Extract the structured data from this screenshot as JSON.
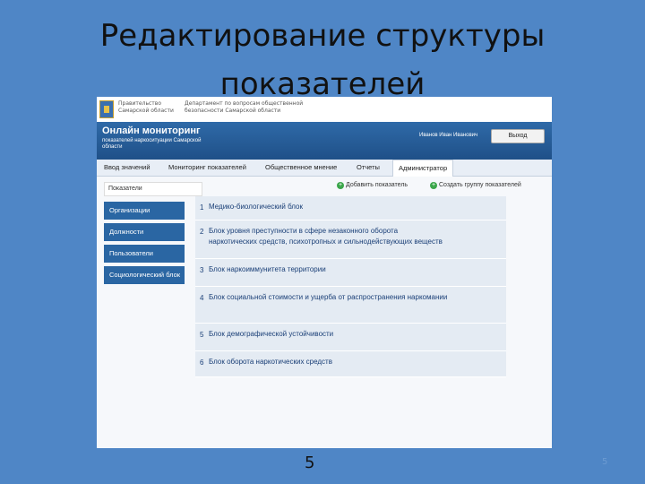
{
  "slide": {
    "title_line1": "Редактирование структуры",
    "title_line2": "показателей",
    "page_number": "5",
    "corner_number": "5"
  },
  "app": {
    "gov_label": "Правительство Самарской области",
    "dept_label": "Департамент по вопросам общественной безопасности Самарской области",
    "title": "Онлайн мониторинг",
    "subtitle": "показателей наркоситуации Самарской области",
    "user_name": "Иванов Иван Иванович",
    "logout_label": "Выход"
  },
  "tabs": [
    {
      "label": "Ввод значений"
    },
    {
      "label": "Мониторинг показателей"
    },
    {
      "label": "Общественное мнение"
    },
    {
      "label": "Отчеты"
    },
    {
      "label": "Администратор"
    }
  ],
  "toolbar": {
    "search_label": "Показатели",
    "add_indicator": "Добавить показатель",
    "add_group": "Создать группу показателей"
  },
  "sidebar": {
    "items": [
      {
        "label": "Организации"
      },
      {
        "label": "Должности"
      },
      {
        "label": "Пользователи"
      },
      {
        "label": "Социологический блок"
      }
    ]
  },
  "blocks": [
    {
      "num": "1",
      "line1": "Медико-биологический блок",
      "line2": ""
    },
    {
      "num": "2",
      "line1": "Блок уровня преступности в сфере незаконного оборота",
      "line2": "наркотических средств, психотропных и сильнодействующих веществ"
    },
    {
      "num": "3",
      "line1": "Блок наркоиммунитета территории",
      "line2": ""
    },
    {
      "num": "4",
      "line1": "Блок социальной стоимости и ущерба от распространения наркомании",
      "line2": ""
    },
    {
      "num": "5",
      "line1": "Блок демографической устойчивости",
      "line2": ""
    },
    {
      "num": "6",
      "line1": "Блок оборота наркотических средств",
      "line2": ""
    }
  ]
}
